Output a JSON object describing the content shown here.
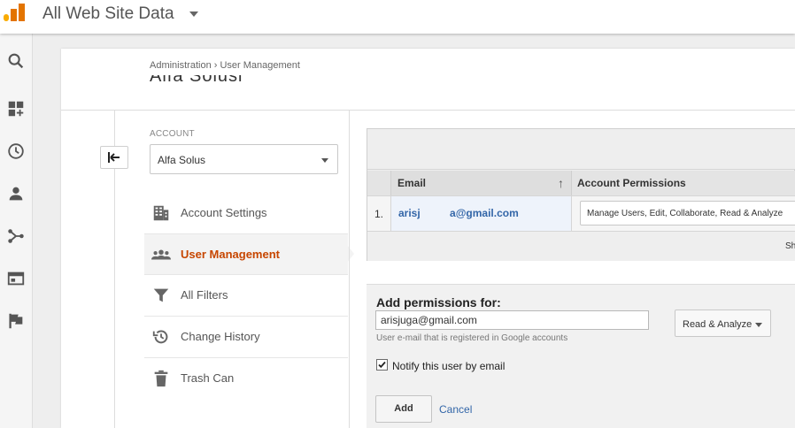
{
  "topbar": {
    "account_title": "All Web Site Data"
  },
  "rail": {
    "icons": [
      "search-icon",
      "customization-icon",
      "realtime-clock-icon",
      "audience-person-icon",
      "acquisition-icon",
      "behavior-icon",
      "conversions-flag-icon"
    ]
  },
  "header": {
    "breadcrumb": "Administration › User Management",
    "page_title": "Alfa Solusi"
  },
  "account": {
    "label": "ACCOUNT",
    "selected": "Alfa Solusi"
  },
  "nav": {
    "items": [
      {
        "label": "Account Settings",
        "icon": "building-icon"
      },
      {
        "label": "User Management",
        "icon": "users-icon"
      },
      {
        "label": "All Filters",
        "icon": "filter-icon"
      },
      {
        "label": "Change History",
        "icon": "history-icon"
      },
      {
        "label": "Trash Can",
        "icon": "trash-icon"
      }
    ],
    "active_item": "User Management"
  },
  "users_table": {
    "columns": [
      "Email",
      "Account Permissions"
    ],
    "rows": [
      {
        "num": "1.",
        "email": "arisj          a@gmail.com",
        "permissions": "Manage Users, Edit, Collaborate, Read & Analyze"
      }
    ],
    "footer_text": "Sh"
  },
  "add_permissions": {
    "title": "Add permissions for:",
    "email_value": "arisjuga@gmail.com",
    "hint": "User e-mail that is registered in Google accounts",
    "role": "Read & Analyze",
    "notify_label": "Notify this user by email",
    "notify_checked": true,
    "add_label": "Add",
    "cancel_label": "Cancel"
  },
  "colors": {
    "accent": "#c74600",
    "link": "#3366a8"
  }
}
